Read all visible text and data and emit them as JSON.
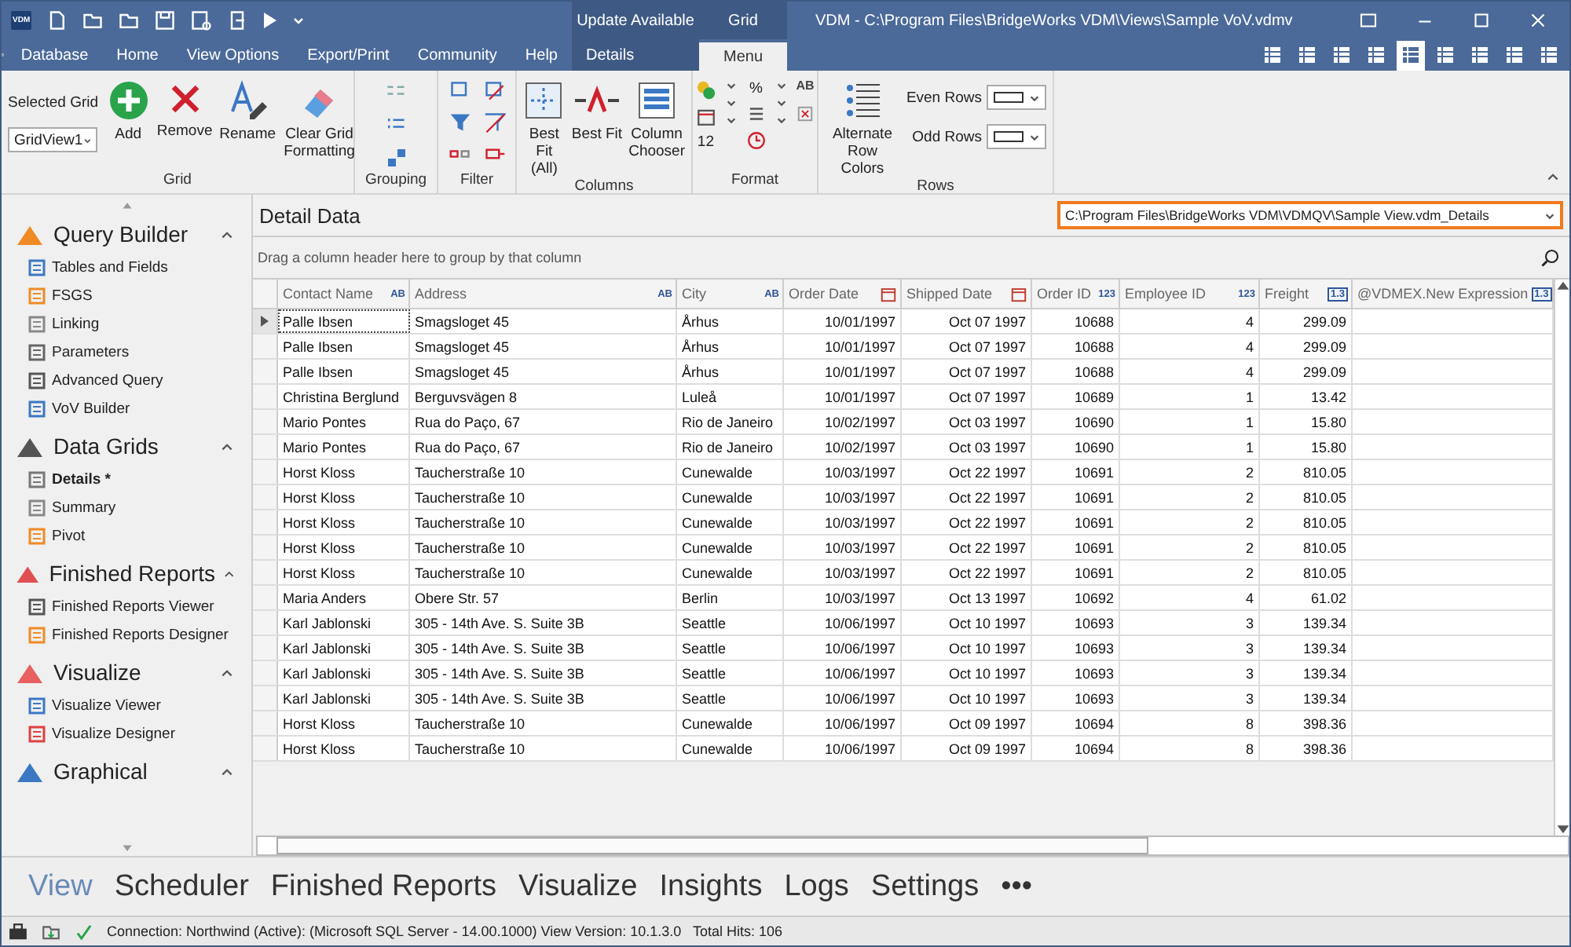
{
  "quick_access": {
    "logo": "VDM"
  },
  "title_bar": {
    "contextual": [
      "Update Available",
      "Grid"
    ],
    "title": "VDM - C:\\Program Files\\BridgeWorks VDM\\Views\\Sample VoV.vdmv"
  },
  "menu_tabs": [
    {
      "label": "Database",
      "selected": false,
      "contextual": false
    },
    {
      "label": "Home",
      "selected": false,
      "contextual": false
    },
    {
      "label": "View Options",
      "selected": false,
      "contextual": false
    },
    {
      "label": "Export/Print",
      "selected": false,
      "contextual": false
    },
    {
      "label": "Community",
      "selected": false,
      "contextual": false
    },
    {
      "label": "Help",
      "selected": false,
      "contextual": false
    },
    {
      "label": "Details",
      "selected": false,
      "contextual": true
    },
    {
      "label": "Menu",
      "selected": true,
      "contextual": true
    }
  ],
  "view_buttons": [
    {
      "selected": false
    },
    {
      "selected": false
    },
    {
      "selected": false
    },
    {
      "selected": false
    },
    {
      "selected": true
    },
    {
      "selected": false
    },
    {
      "selected": false
    },
    {
      "selected": false
    },
    {
      "selected": false
    }
  ],
  "ribbon": {
    "grid": {
      "label": "Grid",
      "selector_label": "Selected Grid",
      "selector_value": "GridView1",
      "buttons": [
        {
          "kind": "add",
          "label": "Add"
        },
        {
          "kind": "remove",
          "label": "Remove"
        },
        {
          "kind": "rename",
          "label": "Rename"
        },
        {
          "kind": "clear",
          "label": "Clear Grid Formatting"
        }
      ]
    },
    "grouping": {
      "label": "Grouping"
    },
    "filter": {
      "label": "Filter"
    },
    "columns": {
      "label": "Columns",
      "buttons": [
        {
          "kind": "fit_all",
          "label": "Best Fit (All)"
        },
        {
          "kind": "fit",
          "label": "Best Fit"
        },
        {
          "kind": "chooser",
          "label": "Column Chooser"
        }
      ]
    },
    "format": {
      "label": "Format",
      "percent": "%",
      "size": "12",
      "case": "AB"
    },
    "rows": {
      "label": "Rows",
      "button": "Alternate Row Colors",
      "even": "Even Rows",
      "odd": "Odd Rows"
    }
  },
  "sidebar": {
    "sections": [
      {
        "title": "Query Builder",
        "expanded": true,
        "items": [
          {
            "label": "Tables and Fields",
            "selected": false
          },
          {
            "label": "FSGS",
            "selected": false
          },
          {
            "label": "Linking",
            "selected": false
          },
          {
            "label": "Parameters",
            "selected": false
          },
          {
            "label": "Advanced Query",
            "selected": false
          },
          {
            "label": "VoV Builder",
            "selected": false
          }
        ]
      },
      {
        "title": "Data Grids",
        "expanded": true,
        "items": [
          {
            "label": "Details *",
            "selected": true
          },
          {
            "label": "Summary",
            "selected": false
          },
          {
            "label": "Pivot",
            "selected": false
          }
        ]
      },
      {
        "title": "Finished Reports",
        "expanded": true,
        "items": [
          {
            "label": "Finished Reports Viewer",
            "selected": false
          },
          {
            "label": "Finished Reports Designer",
            "selected": false
          }
        ]
      },
      {
        "title": "Visualize",
        "expanded": true,
        "items": [
          {
            "label": "Visualize Viewer",
            "selected": false
          },
          {
            "label": "Visualize Designer",
            "selected": false
          }
        ]
      },
      {
        "title": "Graphical",
        "expanded": true
      }
    ]
  },
  "panel": {
    "title": "Detail Data",
    "path": "C:\\Program Files\\BridgeWorks VDM\\VDMQV\\Sample View.vdm_Details",
    "group_hint": "Drag a column header here to group by that column"
  },
  "table": {
    "columns": [
      {
        "label": "Contact Name",
        "kind": "text",
        "badge": "AB"
      },
      {
        "label": "Address",
        "kind": "text",
        "badge": "AB"
      },
      {
        "label": "City",
        "kind": "text",
        "badge": "AB"
      },
      {
        "label": "Order Date",
        "kind": "date"
      },
      {
        "label": "Shipped Date",
        "kind": "date"
      },
      {
        "label": "Order ID",
        "kind": "integer",
        "badge": "123"
      },
      {
        "label": "Employee ID",
        "kind": "integer",
        "badge": "123"
      },
      {
        "label": "Freight",
        "kind": "decimal",
        "badge": "1.3"
      },
      {
        "label": "@VDMEX.New Expression",
        "kind": "decimal",
        "badge": "1.3"
      }
    ],
    "rows": [
      {
        "selected": true,
        "cells": [
          "Palle Ibsen",
          "Smagsloget 45",
          "Århus",
          "10/01/1997",
          "Oct 07 1997",
          "10688",
          "4",
          "299.09",
          ""
        ]
      },
      {
        "selected": false,
        "cells": [
          "Palle Ibsen",
          "Smagsloget 45",
          "Århus",
          "10/01/1997",
          "Oct 07 1997",
          "10688",
          "4",
          "299.09",
          ""
        ]
      },
      {
        "selected": false,
        "cells": [
          "Palle Ibsen",
          "Smagsloget 45",
          "Århus",
          "10/01/1997",
          "Oct 07 1997",
          "10688",
          "4",
          "299.09",
          ""
        ]
      },
      {
        "selected": false,
        "cells": [
          "Christina Berglund",
          "Berguvsvägen  8",
          "Luleå",
          "10/01/1997",
          "Oct 07 1997",
          "10689",
          "1",
          "13.42",
          ""
        ]
      },
      {
        "selected": false,
        "cells": [
          "Mario Pontes",
          "Rua do Paço, 67",
          "Rio de Janeiro",
          "10/02/1997",
          "Oct 03 1997",
          "10690",
          "1",
          "15.80",
          ""
        ]
      },
      {
        "selected": false,
        "cells": [
          "Mario Pontes",
          "Rua do Paço, 67",
          "Rio de Janeiro",
          "10/02/1997",
          "Oct 03 1997",
          "10690",
          "1",
          "15.80",
          ""
        ]
      },
      {
        "selected": false,
        "cells": [
          "Horst Kloss",
          "Taucherstraße 10",
          "Cunewalde",
          "10/03/1997",
          "Oct 22 1997",
          "10691",
          "2",
          "810.05",
          ""
        ]
      },
      {
        "selected": false,
        "cells": [
          "Horst Kloss",
          "Taucherstraße 10",
          "Cunewalde",
          "10/03/1997",
          "Oct 22 1997",
          "10691",
          "2",
          "810.05",
          ""
        ]
      },
      {
        "selected": false,
        "cells": [
          "Horst Kloss",
          "Taucherstraße 10",
          "Cunewalde",
          "10/03/1997",
          "Oct 22 1997",
          "10691",
          "2",
          "810.05",
          ""
        ]
      },
      {
        "selected": false,
        "cells": [
          "Horst Kloss",
          "Taucherstraße 10",
          "Cunewalde",
          "10/03/1997",
          "Oct 22 1997",
          "10691",
          "2",
          "810.05",
          ""
        ]
      },
      {
        "selected": false,
        "cells": [
          "Horst Kloss",
          "Taucherstraße 10",
          "Cunewalde",
          "10/03/1997",
          "Oct 22 1997",
          "10691",
          "2",
          "810.05",
          ""
        ]
      },
      {
        "selected": false,
        "cells": [
          "Maria Anders",
          "Obere Str. 57",
          "Berlin",
          "10/03/1997",
          "Oct 13 1997",
          "10692",
          "4",
          "61.02",
          ""
        ]
      },
      {
        "selected": false,
        "cells": [
          "Karl Jablonski",
          "305 - 14th Ave. S. Suite 3B",
          "Seattle",
          "10/06/1997",
          "Oct 10 1997",
          "10693",
          "3",
          "139.34",
          ""
        ]
      },
      {
        "selected": false,
        "cells": [
          "Karl Jablonski",
          "305 - 14th Ave. S. Suite 3B",
          "Seattle",
          "10/06/1997",
          "Oct 10 1997",
          "10693",
          "3",
          "139.34",
          ""
        ]
      },
      {
        "selected": false,
        "cells": [
          "Karl Jablonski",
          "305 - 14th Ave. S. Suite 3B",
          "Seattle",
          "10/06/1997",
          "Oct 10 1997",
          "10693",
          "3",
          "139.34",
          ""
        ]
      },
      {
        "selected": false,
        "cells": [
          "Karl Jablonski",
          "305 - 14th Ave. S. Suite 3B",
          "Seattle",
          "10/06/1997",
          "Oct 10 1997",
          "10693",
          "3",
          "139.34",
          ""
        ]
      },
      {
        "selected": false,
        "cells": [
          "Horst Kloss",
          "Taucherstraße 10",
          "Cunewalde",
          "10/06/1997",
          "Oct 09 1997",
          "10694",
          "8",
          "398.36",
          ""
        ]
      },
      {
        "selected": false,
        "cells": [
          "Horst Kloss",
          "Taucherstraße 10",
          "Cunewalde",
          "10/06/1997",
          "Oct 09 1997",
          "10694",
          "8",
          "398.36",
          ""
        ]
      }
    ]
  },
  "bottom_nav": [
    {
      "label": "View",
      "selected": true
    },
    {
      "label": "Scheduler",
      "selected": false
    },
    {
      "label": "Finished Reports",
      "selected": false
    },
    {
      "label": "Visualize",
      "selected": false
    },
    {
      "label": "Insights",
      "selected": false
    },
    {
      "label": "Logs",
      "selected": false
    },
    {
      "label": "Settings",
      "selected": false
    },
    {
      "label": "•••",
      "selected": false
    }
  ],
  "status_bar": {
    "text": "Connection: Northwind (Active): (Microsoft SQL Server - 14.00.1000) View Version: 10.1.3.0   Total Hits: 106"
  }
}
